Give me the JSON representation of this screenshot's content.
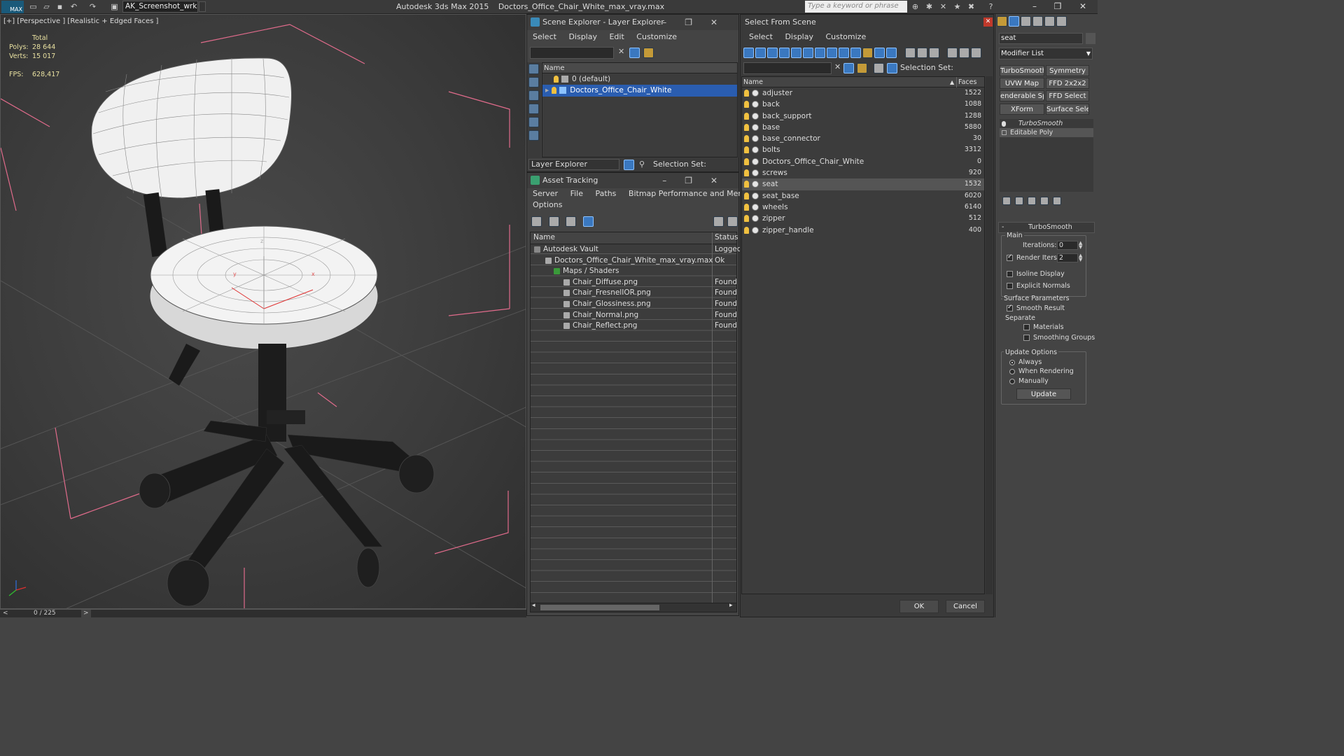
{
  "titlebar": {
    "logo": "MAX",
    "workspace": "AK_Screenshot_wrksp",
    "app_title": "Autodesk 3ds Max  2015",
    "file_title": "Doctors_Office_Chair_White_max_vray.max",
    "keyword_placeholder": "Type a keyword or phrase"
  },
  "viewport": {
    "label": "[+] [Perspective ] [Realistic + Edged Faces ]",
    "stats": {
      "total_label": "Total",
      "polys_label": "Polys:",
      "polys_value": "28 644",
      "verts_label": "Verts:",
      "verts_value": "15 017",
      "fps_label": "FPS:",
      "fps_value": "628,417"
    },
    "axis": {
      "z": "z",
      "x": "x",
      "y": "y"
    }
  },
  "timeline": {
    "frame": "0 / 225",
    "prev": "<",
    "next": ">"
  },
  "scene_explorer": {
    "title": "Scene Explorer - Layer Explorer",
    "menu": [
      "Select",
      "Display",
      "Edit",
      "Customize"
    ],
    "column": "Name",
    "layers": [
      {
        "name": "0 (default)",
        "selected": false
      },
      {
        "name": "Doctors_Office_Chair_White",
        "selected": true
      }
    ],
    "footer_label": "Layer Explorer",
    "selection_set_label": "Selection Set:"
  },
  "asset_tracking": {
    "title": "Asset Tracking",
    "menu": [
      "Server",
      "File",
      "Paths",
      "Bitmap Performance and Memory"
    ],
    "menu2": "Options",
    "columns": [
      "Name",
      "Status"
    ],
    "rows": [
      {
        "name": "Autodesk Vault",
        "status": "Logged",
        "level": 1
      },
      {
        "name": "Doctors_Office_Chair_White_max_vray.max",
        "status": "Ok",
        "level": 2
      },
      {
        "name": "Maps / Shaders",
        "status": "",
        "level": 3
      },
      {
        "name": "Chair_Diffuse.png",
        "status": "Found",
        "level": 4
      },
      {
        "name": "Chair_FresnelIOR.png",
        "status": "Found",
        "level": 4
      },
      {
        "name": "Chair_Glossiness.png",
        "status": "Found",
        "level": 4
      },
      {
        "name": "Chair_Normal.png",
        "status": "Found",
        "level": 4
      },
      {
        "name": "Chair_Reflect.png",
        "status": "Found",
        "level": 4
      }
    ]
  },
  "select_from_scene": {
    "title": "Select From Scene",
    "menu": [
      "Select",
      "Display",
      "Customize"
    ],
    "selection_set_label": "Selection Set:",
    "columns": [
      "Name",
      "Faces"
    ],
    "objects": [
      {
        "name": "adjuster",
        "faces": "1522"
      },
      {
        "name": "back",
        "faces": "1088"
      },
      {
        "name": "back_support",
        "faces": "1288"
      },
      {
        "name": "base",
        "faces": "5880"
      },
      {
        "name": "base_connector",
        "faces": "30"
      },
      {
        "name": "bolts",
        "faces": "3312"
      },
      {
        "name": "Doctors_Office_Chair_White",
        "faces": "0"
      },
      {
        "name": "screws",
        "faces": "920"
      },
      {
        "name": "seat",
        "faces": "1532"
      },
      {
        "name": "seat_base",
        "faces": "6020"
      },
      {
        "name": "wheels",
        "faces": "6140"
      },
      {
        "name": "zipper",
        "faces": "512"
      },
      {
        "name": "zipper_handle",
        "faces": "400"
      }
    ],
    "selected": "seat",
    "ok": "OK",
    "cancel": "Cancel"
  },
  "command_panel": {
    "object_name": "seat",
    "modifier_list": "Modifier List",
    "buttons": [
      "TurboSmooth",
      "Symmetry",
      "UVW Map",
      "FFD 2x2x2",
      "enderable Splir",
      "FFD Select",
      "XForm",
      "Surface Select"
    ],
    "stack": [
      "TurboSmooth",
      "Editable Poly"
    ],
    "rollout_title": "TurboSmooth",
    "main_label": "Main",
    "iterations_label": "Iterations:",
    "iterations_value": "0",
    "render_iters_label": "Render Iters:",
    "render_iters_value": "2",
    "isoline": "Isoline Display",
    "explicit": "Explicit Normals",
    "surface_params": "Surface Parameters",
    "smooth_result": "Smooth Result",
    "separate": "Separate",
    "materials": "Materials",
    "smoothing_groups": "Smoothing Groups",
    "update_options": "Update Options",
    "always": "Always",
    "when_rendering": "When Rendering",
    "manually": "Manually",
    "update_btn": "Update",
    "minus": "-"
  },
  "colors": {
    "accent": "#3a78c0",
    "selection": "#2a5db0",
    "box": "#e06b8b",
    "stats": "#e8e0a0"
  }
}
